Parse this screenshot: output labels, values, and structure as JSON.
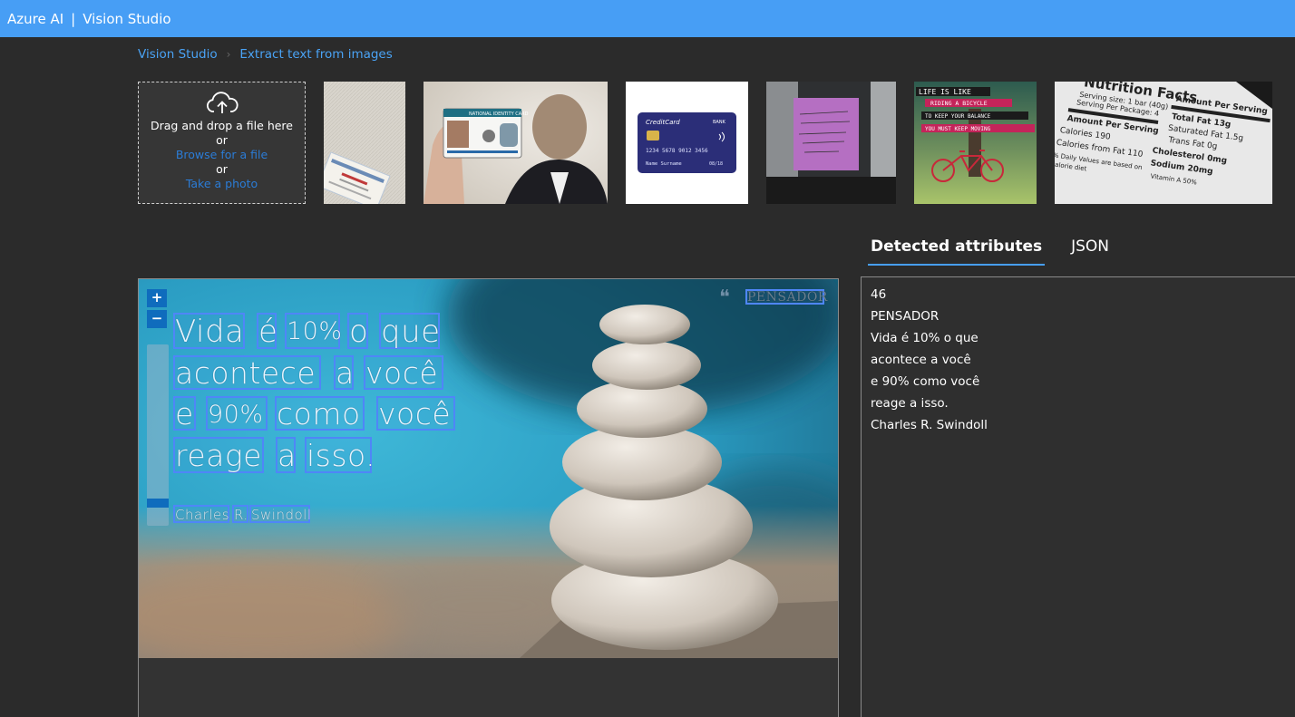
{
  "header": {
    "brand": "Azure AI",
    "separator": "|",
    "product": "Vision Studio"
  },
  "breadcrumb": {
    "items": [
      "Vision Studio",
      "Extract text from images"
    ]
  },
  "upload": {
    "drag_text": "Drag and drop a file here",
    "or1": "or",
    "browse_link": "Browse for a file",
    "or2": "or",
    "photo_link": "Take a photo"
  },
  "samples": {
    "thumbnails": [
      "social-security-card",
      "national-identity-card",
      "credit-card",
      "sticky-note",
      "life-is-like-riding-a-bicycle",
      "nutrition-facts"
    ],
    "id_card_title": "NATIONAL IDENTITY CARD",
    "credit_card": {
      "title": "CreditCard",
      "bank": "BANK",
      "number": "1234 5678 9012 3456",
      "name": "Name Surname",
      "expiry": "08/18"
    },
    "bike_lines": [
      "LIFE IS LIKE",
      "RIDING A BICYCLE",
      "TO KEEP YOUR BALANCE",
      "YOU MUST KEEP MOVING"
    ],
    "nutrition_lines": [
      "Nutrition Facts",
      "Serving size: 1 bar (40g)",
      "Serving Per Package: 4",
      "Amount Per Serving",
      "Calories 190",
      "Calories from Fat 110",
      "Amount Per Serving",
      "Total Fat 13g",
      "Saturated Fat 1.5g",
      "Trans Fat 0g",
      "Cholesterol 0mg",
      "Sodium 20mg",
      "% Daily Values are based on",
      "calorie diet",
      "Vitamin A 50%"
    ]
  },
  "tabs": [
    {
      "label": "Detected attributes",
      "active": true
    },
    {
      "label": "JSON",
      "active": false
    }
  ],
  "viewer": {
    "zoom_in": "+",
    "zoom_out": "−",
    "quote_mark": "❝",
    "words": {
      "pensador": "PENSADOR",
      "line1": [
        "Vida",
        "é",
        "10%",
        "o",
        "que"
      ],
      "line2": [
        "acontece",
        "a",
        "você"
      ],
      "line3": [
        "e",
        "90%",
        "como",
        "você"
      ],
      "line4": [
        "reage",
        "a",
        "isso."
      ],
      "author": [
        "Charles",
        "R.",
        "Swindoll"
      ]
    }
  },
  "results": {
    "lines": [
      "46",
      "PENSADOR",
      "Vida é 10% o que",
      "acontece a você",
      "e 90% como você",
      "reage a isso.",
      "Charles R. Swindoll"
    ]
  },
  "colors": {
    "header_bg": "#479ef5",
    "accent": "#0f6cbd",
    "link": "#4aa3f5",
    "bbox": "#4f86f7",
    "page_bg": "#2b2b2b"
  }
}
